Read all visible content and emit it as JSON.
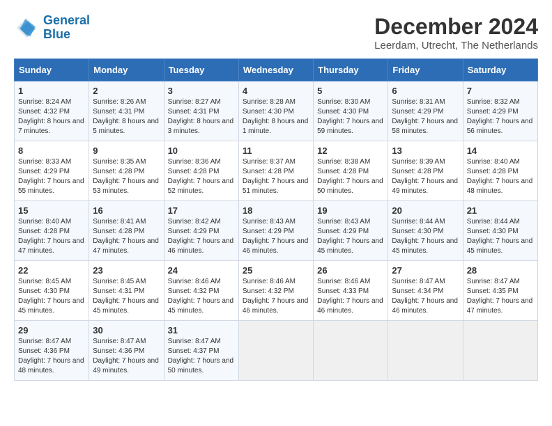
{
  "header": {
    "logo_line1": "General",
    "logo_line2": "Blue",
    "title": "December 2024",
    "subtitle": "Leerdam, Utrecht, The Netherlands"
  },
  "weekdays": [
    "Sunday",
    "Monday",
    "Tuesday",
    "Wednesday",
    "Thursday",
    "Friday",
    "Saturday"
  ],
  "weeks": [
    [
      {
        "day": "1",
        "text": "Sunrise: 8:24 AM\nSunset: 4:32 PM\nDaylight: 8 hours and 7 minutes."
      },
      {
        "day": "2",
        "text": "Sunrise: 8:26 AM\nSunset: 4:31 PM\nDaylight: 8 hours and 5 minutes."
      },
      {
        "day": "3",
        "text": "Sunrise: 8:27 AM\nSunset: 4:31 PM\nDaylight: 8 hours and 3 minutes."
      },
      {
        "day": "4",
        "text": "Sunrise: 8:28 AM\nSunset: 4:30 PM\nDaylight: 8 hours and 1 minute."
      },
      {
        "day": "5",
        "text": "Sunrise: 8:30 AM\nSunset: 4:30 PM\nDaylight: 7 hours and 59 minutes."
      },
      {
        "day": "6",
        "text": "Sunrise: 8:31 AM\nSunset: 4:29 PM\nDaylight: 7 hours and 58 minutes."
      },
      {
        "day": "7",
        "text": "Sunrise: 8:32 AM\nSunset: 4:29 PM\nDaylight: 7 hours and 56 minutes."
      }
    ],
    [
      {
        "day": "8",
        "text": "Sunrise: 8:33 AM\nSunset: 4:29 PM\nDaylight: 7 hours and 55 minutes."
      },
      {
        "day": "9",
        "text": "Sunrise: 8:35 AM\nSunset: 4:28 PM\nDaylight: 7 hours and 53 minutes."
      },
      {
        "day": "10",
        "text": "Sunrise: 8:36 AM\nSunset: 4:28 PM\nDaylight: 7 hours and 52 minutes."
      },
      {
        "day": "11",
        "text": "Sunrise: 8:37 AM\nSunset: 4:28 PM\nDaylight: 7 hours and 51 minutes."
      },
      {
        "day": "12",
        "text": "Sunrise: 8:38 AM\nSunset: 4:28 PM\nDaylight: 7 hours and 50 minutes."
      },
      {
        "day": "13",
        "text": "Sunrise: 8:39 AM\nSunset: 4:28 PM\nDaylight: 7 hours and 49 minutes."
      },
      {
        "day": "14",
        "text": "Sunrise: 8:40 AM\nSunset: 4:28 PM\nDaylight: 7 hours and 48 minutes."
      }
    ],
    [
      {
        "day": "15",
        "text": "Sunrise: 8:40 AM\nSunset: 4:28 PM\nDaylight: 7 hours and 47 minutes."
      },
      {
        "day": "16",
        "text": "Sunrise: 8:41 AM\nSunset: 4:28 PM\nDaylight: 7 hours and 47 minutes."
      },
      {
        "day": "17",
        "text": "Sunrise: 8:42 AM\nSunset: 4:29 PM\nDaylight: 7 hours and 46 minutes."
      },
      {
        "day": "18",
        "text": "Sunrise: 8:43 AM\nSunset: 4:29 PM\nDaylight: 7 hours and 46 minutes."
      },
      {
        "day": "19",
        "text": "Sunrise: 8:43 AM\nSunset: 4:29 PM\nDaylight: 7 hours and 45 minutes."
      },
      {
        "day": "20",
        "text": "Sunrise: 8:44 AM\nSunset: 4:30 PM\nDaylight: 7 hours and 45 minutes."
      },
      {
        "day": "21",
        "text": "Sunrise: 8:44 AM\nSunset: 4:30 PM\nDaylight: 7 hours and 45 minutes."
      }
    ],
    [
      {
        "day": "22",
        "text": "Sunrise: 8:45 AM\nSunset: 4:30 PM\nDaylight: 7 hours and 45 minutes."
      },
      {
        "day": "23",
        "text": "Sunrise: 8:45 AM\nSunset: 4:31 PM\nDaylight: 7 hours and 45 minutes."
      },
      {
        "day": "24",
        "text": "Sunrise: 8:46 AM\nSunset: 4:32 PM\nDaylight: 7 hours and 45 minutes."
      },
      {
        "day": "25",
        "text": "Sunrise: 8:46 AM\nSunset: 4:32 PM\nDaylight: 7 hours and 46 minutes."
      },
      {
        "day": "26",
        "text": "Sunrise: 8:46 AM\nSunset: 4:33 PM\nDaylight: 7 hours and 46 minutes."
      },
      {
        "day": "27",
        "text": "Sunrise: 8:47 AM\nSunset: 4:34 PM\nDaylight: 7 hours and 46 minutes."
      },
      {
        "day": "28",
        "text": "Sunrise: 8:47 AM\nSunset: 4:35 PM\nDaylight: 7 hours and 47 minutes."
      }
    ],
    [
      {
        "day": "29",
        "text": "Sunrise: 8:47 AM\nSunset: 4:36 PM\nDaylight: 7 hours and 48 minutes."
      },
      {
        "day": "30",
        "text": "Sunrise: 8:47 AM\nSunset: 4:36 PM\nDaylight: 7 hours and 49 minutes."
      },
      {
        "day": "31",
        "text": "Sunrise: 8:47 AM\nSunset: 4:37 PM\nDaylight: 7 hours and 50 minutes."
      },
      {
        "day": "",
        "text": ""
      },
      {
        "day": "",
        "text": ""
      },
      {
        "day": "",
        "text": ""
      },
      {
        "day": "",
        "text": ""
      }
    ]
  ]
}
